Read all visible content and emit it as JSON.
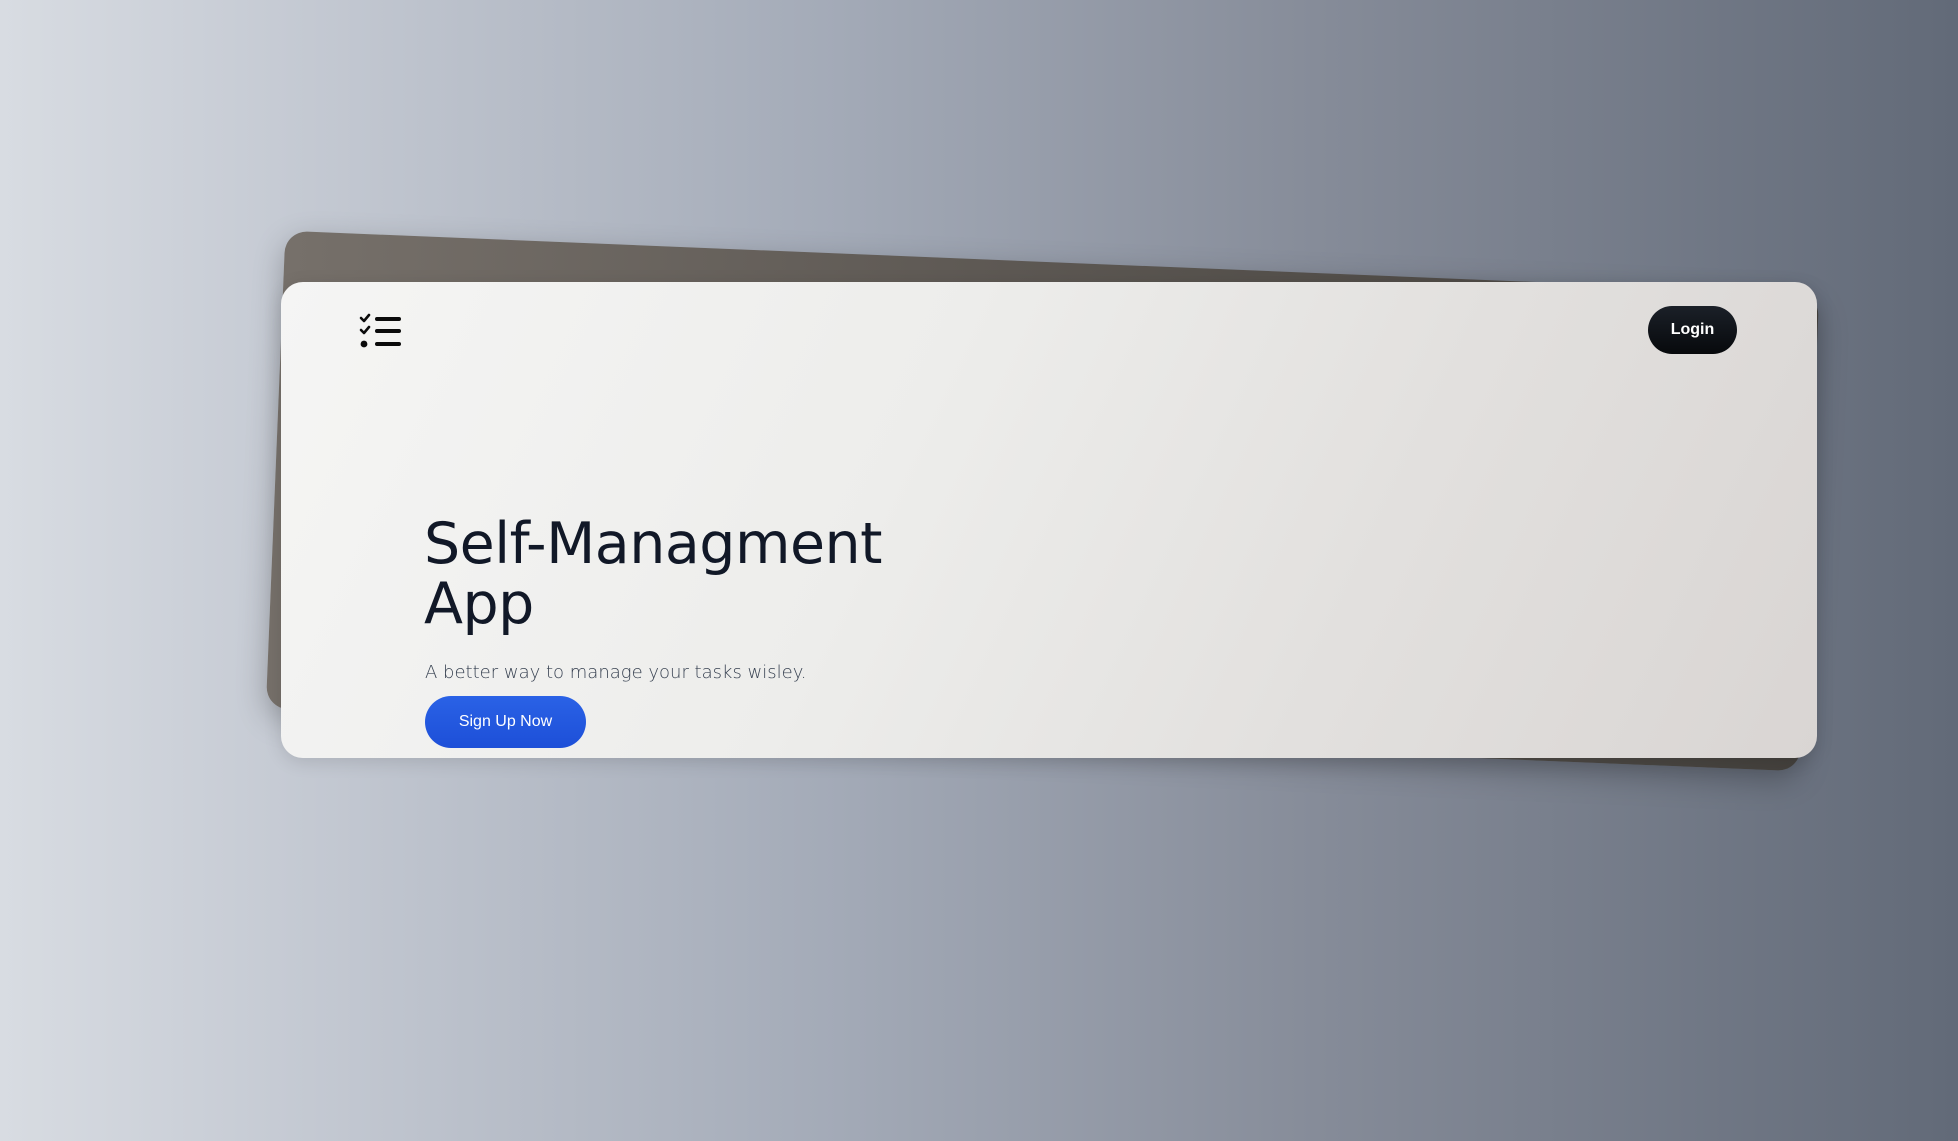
{
  "nav": {
    "logo_icon": "task-list-check-icon",
    "login_label": "Login"
  },
  "hero": {
    "title_line1": "Self-Managment",
    "title_line2": "App",
    "subtitle": "A better way to manage your tasks wisley.",
    "cta_label": "Sign Up Now"
  },
  "colors": {
    "primary": "#1d4fd8",
    "dark": "#0b0e13",
    "heading": "#111827"
  }
}
